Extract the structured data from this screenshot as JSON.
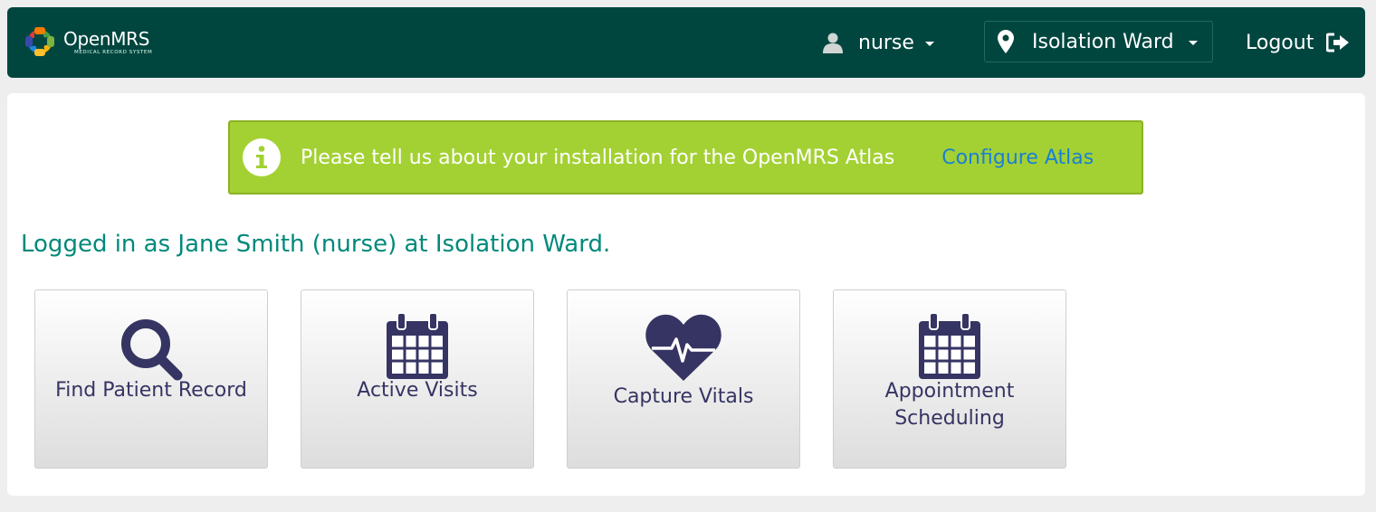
{
  "header": {
    "logo_name": "OpenMRS",
    "logo_sub": "MEDICAL RECORD SYSTEM",
    "user_label": "nurse",
    "location_label": "Isolation Ward",
    "logout_label": "Logout"
  },
  "alert": {
    "message": "Please tell us about your installation for the OpenMRS Atlas",
    "link_label": "Configure Atlas"
  },
  "welcome_text": "Logged in as Jane Smith (nurse) at Isolation Ward.",
  "apps": [
    {
      "label": "Find Patient Record",
      "icon": "search-icon"
    },
    {
      "label": "Active Visits",
      "icon": "calendar-icon"
    },
    {
      "label": "Capture Vitals",
      "icon": "heartbeat-icon"
    },
    {
      "label": "Appointment Scheduling",
      "icon": "calendar-icon"
    }
  ],
  "colors": {
    "header_bg": "#00463f",
    "alert_bg": "#a3d133",
    "link": "#1a7fd6",
    "welcome_text": "#00897b",
    "tile_icon": "#363463"
  }
}
